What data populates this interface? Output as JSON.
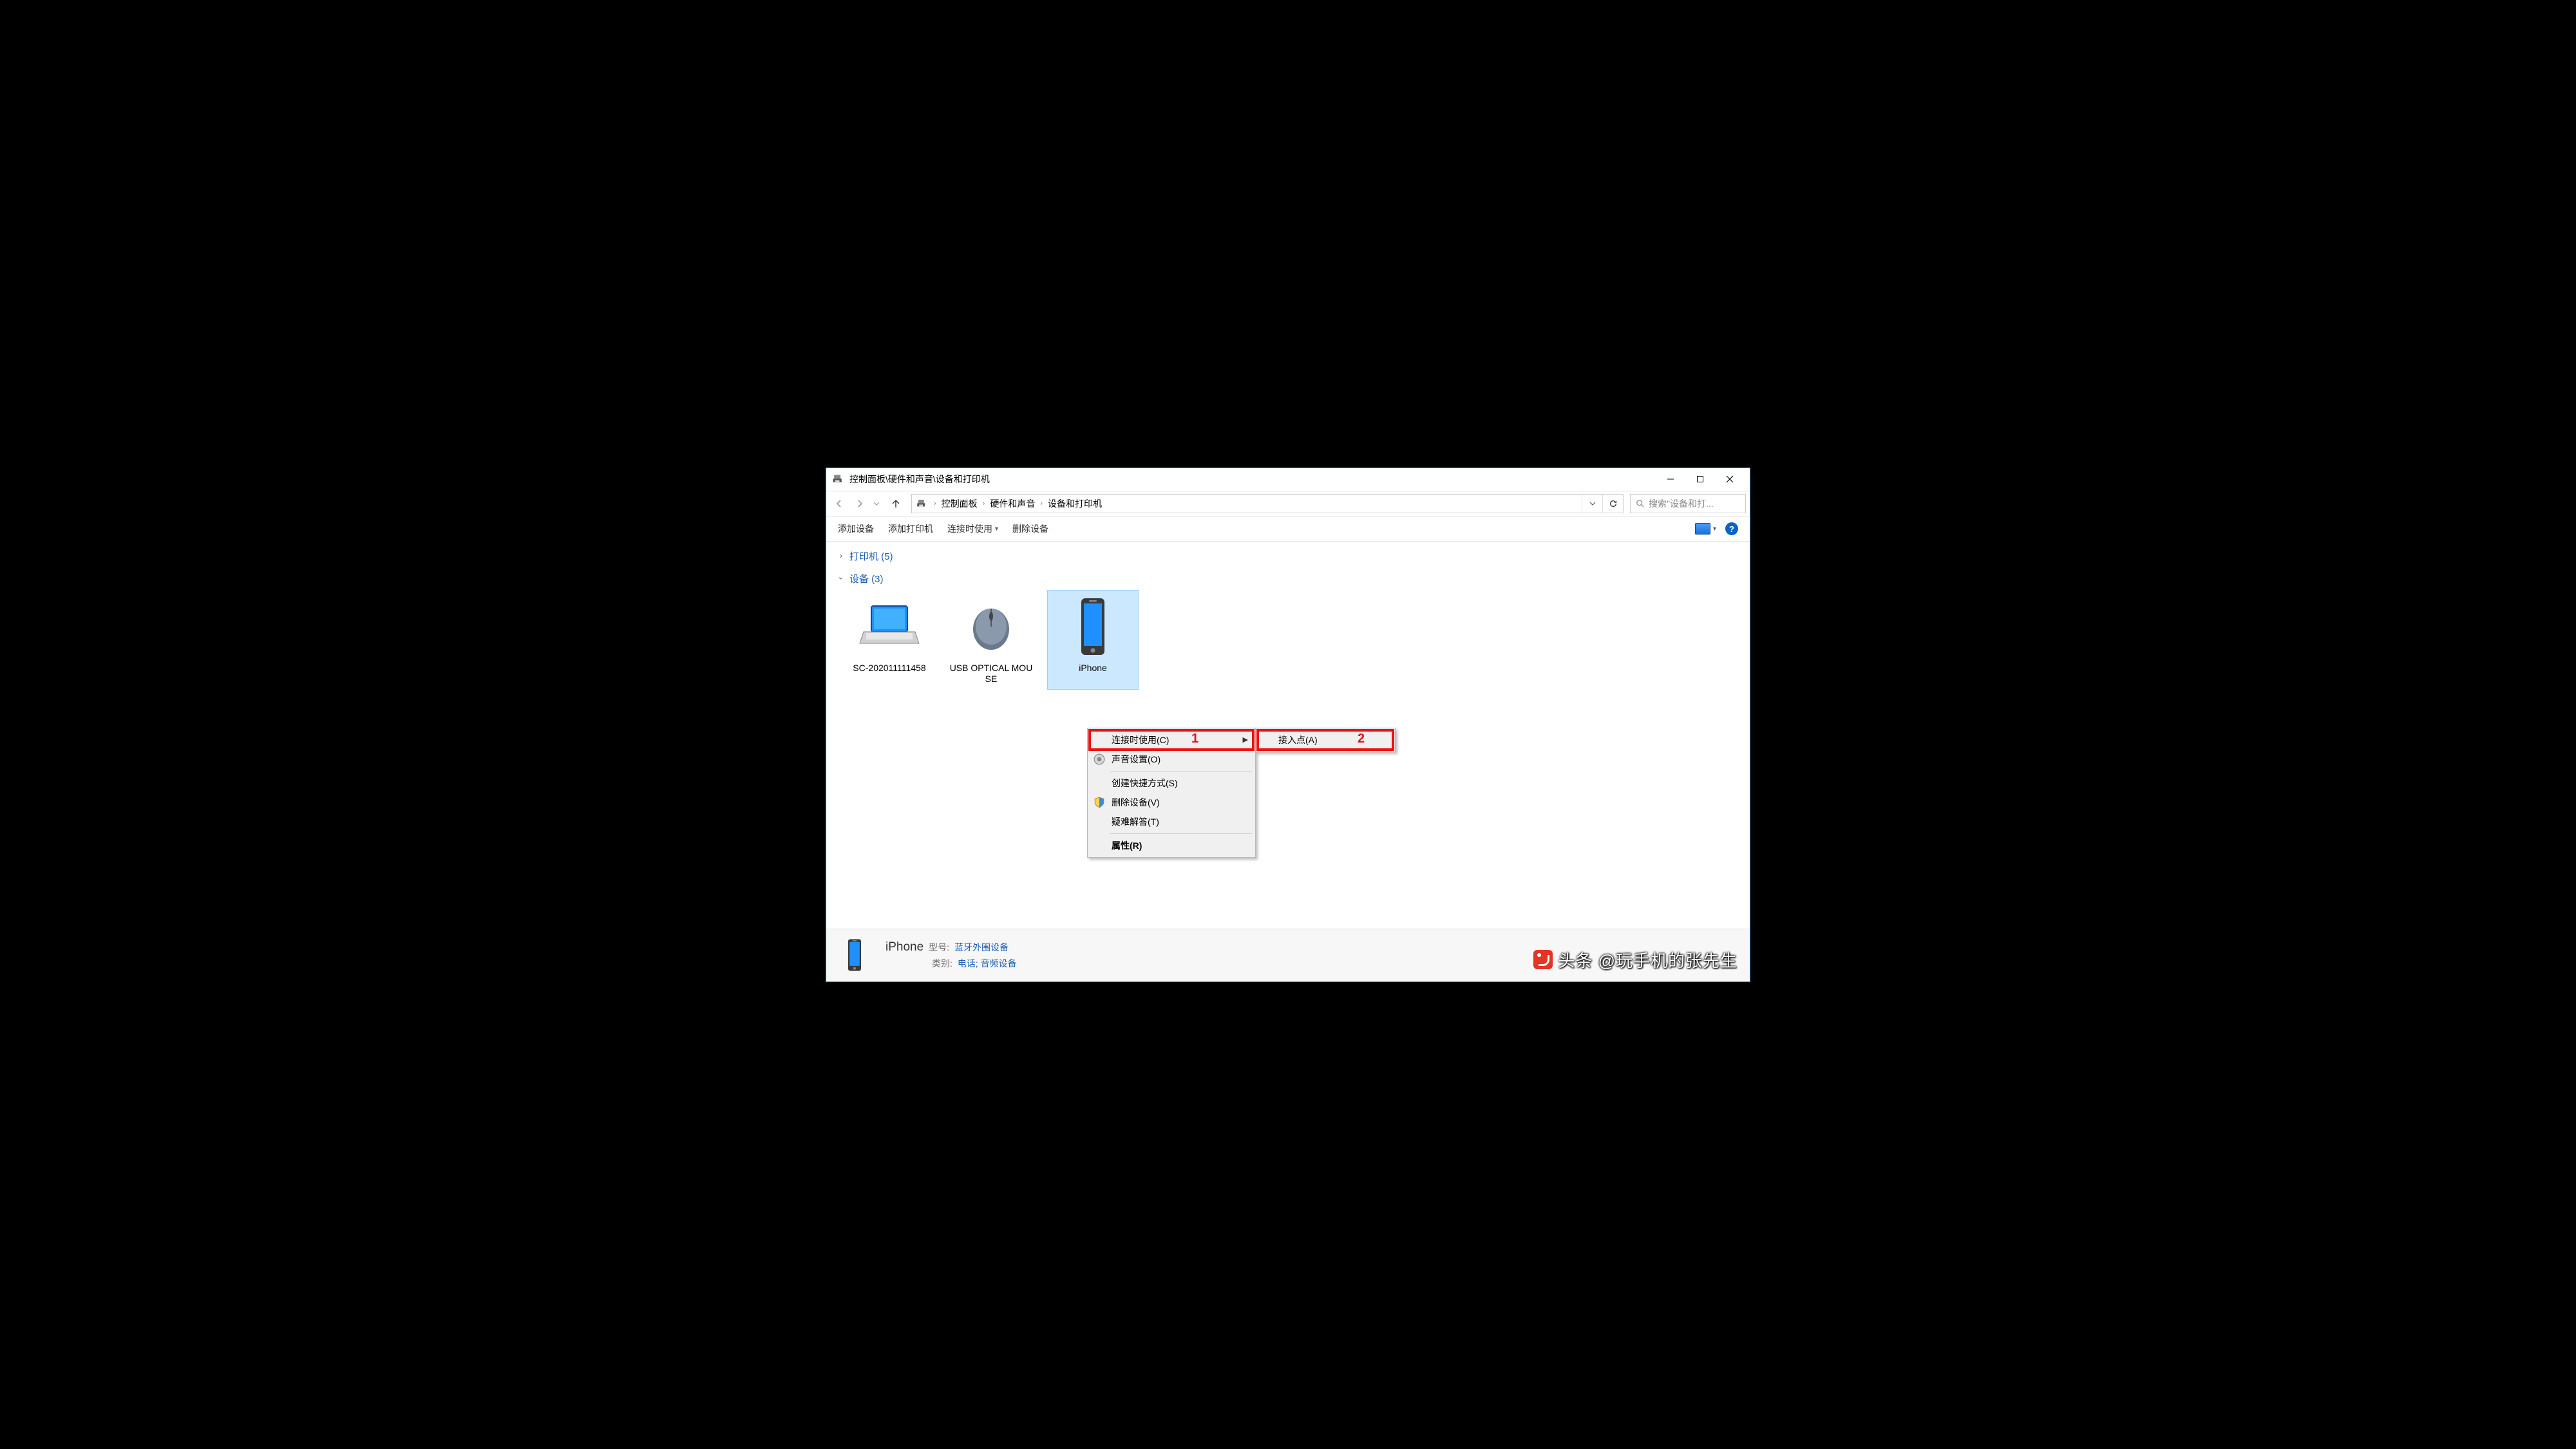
{
  "title": "控制面板\\硬件和声音\\设备和打印机",
  "breadcrumb": {
    "a": "控制面板",
    "b": "硬件和声音",
    "c": "设备和打印机"
  },
  "search_placeholder": "搜索\"设备和打...",
  "toolbar": {
    "add_device": "添加设备",
    "add_printer": "添加打印机",
    "connect_use": "连接时使用",
    "remove_device": "删除设备"
  },
  "groups": {
    "printers": "打印机 (5)",
    "devices": "设备 (3)"
  },
  "devices": {
    "d1": "SC-202011111458",
    "d2": "USB OPTICAL MOUSE",
    "d3": "iPhone"
  },
  "ctx": {
    "connect": "连接时使用(C)",
    "sound": "声音设置(O)",
    "shortcut": "创建快捷方式(S)",
    "remove": "删除设备(V)",
    "troubleshoot": "疑难解答(T)",
    "properties": "属性(R)"
  },
  "submenu": {
    "ap": "接入点(A)"
  },
  "annot": {
    "n1": "1",
    "n2": "2"
  },
  "status": {
    "name": "iPhone",
    "model_lbl": "型号:",
    "model_val": "蓝牙外围设备",
    "cat_lbl": "类别:",
    "cat_val": "电话; 音频设备"
  },
  "watermark": "头条 @玩手机的张先生"
}
